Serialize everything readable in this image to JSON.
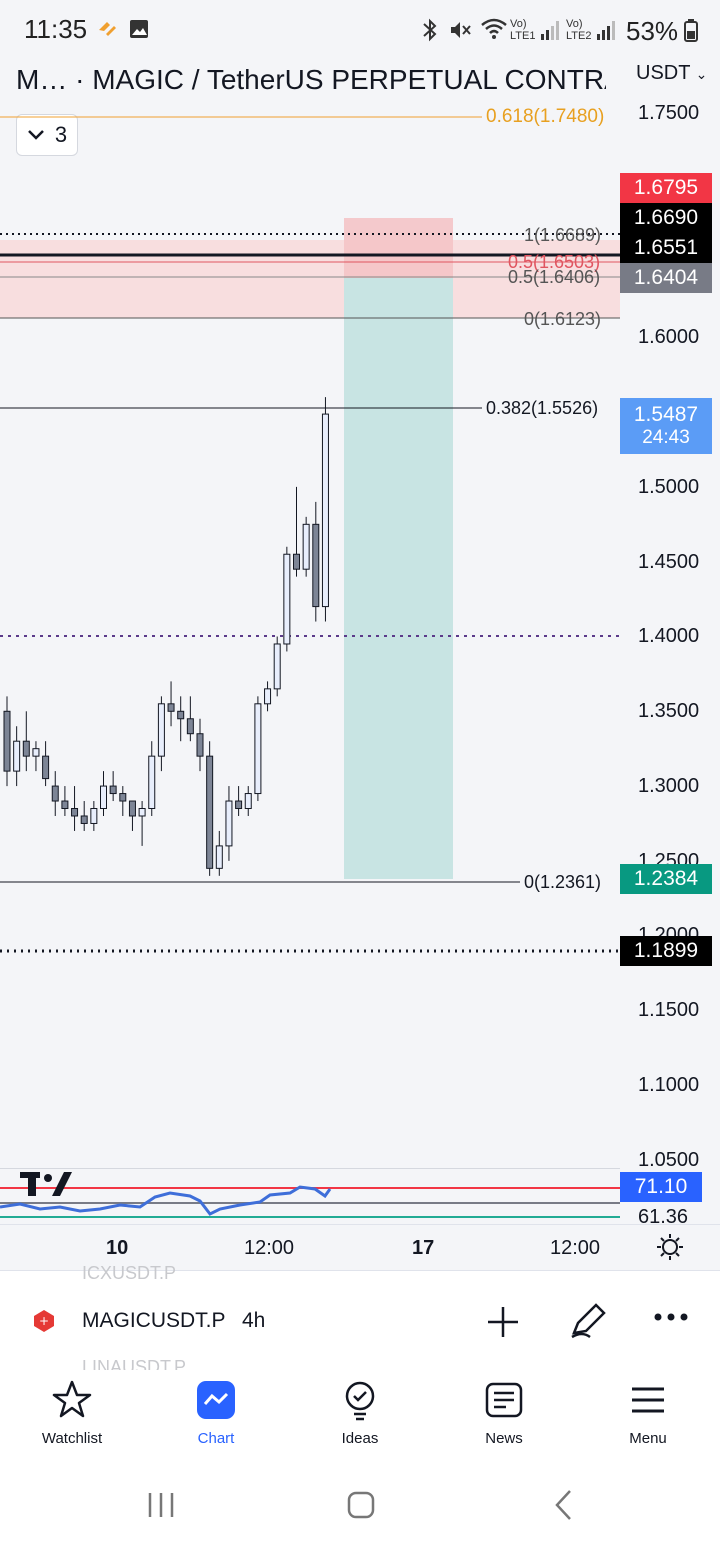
{
  "status_bar": {
    "time": "11:35",
    "network1": "Vo) LTE1",
    "network2": "Vo) LTE2",
    "battery": "53%"
  },
  "header": {
    "title": "M… · MAGIC / TetherUS PERPETUAL CONTRACT",
    "currency": "USDT",
    "indicator_count": "3"
  },
  "price_axis": [
    "1.7500",
    "1.6000",
    "1.5000",
    "1.4500",
    "1.4000",
    "1.3500",
    "1.3000",
    "1.2500",
    "1.2000",
    "1.1500",
    "1.1000",
    "1.0500"
  ],
  "price_labels": {
    "red": "1.6795",
    "black1": "1.6690",
    "black2": "1.6551",
    "gray": "1.6404",
    "last": "1.5487",
    "countdown": "24:43",
    "green": "1.2384",
    "black3": "1.1899"
  },
  "fib_labels": {
    "top": "0.618(1.7480)",
    "f1": "1(1.6689)",
    "f05red": "0.5(1.6503)",
    "f05": "0.5(1.6406)",
    "f0": "0(1.6123)",
    "f0382": "0.382(1.5526)",
    "f0low": "0(1.2361)"
  },
  "indicator": {
    "value1": "71.10",
    "value2": "61.36"
  },
  "time_axis": [
    "10",
    "12:00",
    "17",
    "12:00"
  ],
  "chart_data": {
    "type": "candlestick",
    "symbol": "MAGICUSDT.P",
    "interval": "4h",
    "ylim": [
      1.05,
      1.75
    ],
    "candles": [
      [
        1.35,
        1.36,
        1.3,
        1.31
      ],
      [
        1.31,
        1.34,
        1.3,
        1.33
      ],
      [
        1.33,
        1.35,
        1.31,
        1.32
      ],
      [
        1.32,
        1.33,
        1.31,
        1.325
      ],
      [
        1.32,
        1.33,
        1.3,
        1.305
      ],
      [
        1.3,
        1.31,
        1.28,
        1.29
      ],
      [
        1.29,
        1.3,
        1.28,
        1.285
      ],
      [
        1.285,
        1.3,
        1.27,
        1.28
      ],
      [
        1.28,
        1.29,
        1.27,
        1.275
      ],
      [
        1.275,
        1.29,
        1.27,
        1.285
      ],
      [
        1.285,
        1.31,
        1.28,
        1.3
      ],
      [
        1.3,
        1.31,
        1.29,
        1.295
      ],
      [
        1.295,
        1.3,
        1.28,
        1.29
      ],
      [
        1.29,
        1.29,
        1.27,
        1.28
      ],
      [
        1.28,
        1.29,
        1.26,
        1.285
      ],
      [
        1.285,
        1.33,
        1.28,
        1.32
      ],
      [
        1.32,
        1.36,
        1.31,
        1.355
      ],
      [
        1.355,
        1.37,
        1.34,
        1.35
      ],
      [
        1.35,
        1.36,
        1.33,
        1.345
      ],
      [
        1.345,
        1.36,
        1.33,
        1.335
      ],
      [
        1.335,
        1.345,
        1.31,
        1.32
      ],
      [
        1.32,
        1.33,
        1.24,
        1.245
      ],
      [
        1.245,
        1.27,
        1.24,
        1.26
      ],
      [
        1.26,
        1.3,
        1.25,
        1.29
      ],
      [
        1.29,
        1.3,
        1.28,
        1.285
      ],
      [
        1.285,
        1.3,
        1.28,
        1.295
      ],
      [
        1.295,
        1.36,
        1.29,
        1.355
      ],
      [
        1.355,
        1.37,
        1.35,
        1.365
      ],
      [
        1.365,
        1.4,
        1.36,
        1.395
      ],
      [
        1.395,
        1.46,
        1.39,
        1.455
      ],
      [
        1.455,
        1.5,
        1.44,
        1.445
      ],
      [
        1.445,
        1.48,
        1.44,
        1.475
      ],
      [
        1.475,
        1.49,
        1.41,
        1.42
      ],
      [
        1.42,
        1.56,
        1.41,
        1.5487
      ]
    ]
  },
  "symbol_bar": {
    "ghost_top": "ICXUSDT.P",
    "ghost_bottom": "LINAUSDT.P",
    "symbol": "MAGICUSDT.P",
    "interval": "4h"
  },
  "nav": {
    "watchlist": "Watchlist",
    "chart": "Chart",
    "ideas": "Ideas",
    "news": "News",
    "menu": "Menu"
  },
  "colors": {
    "accent": "#2962ff",
    "red_label": "#f23645",
    "green_label": "#089981",
    "last_price": "#5b9cf6",
    "teal_zone": "#c8e4e3",
    "red_zone": "#f8d9da"
  }
}
